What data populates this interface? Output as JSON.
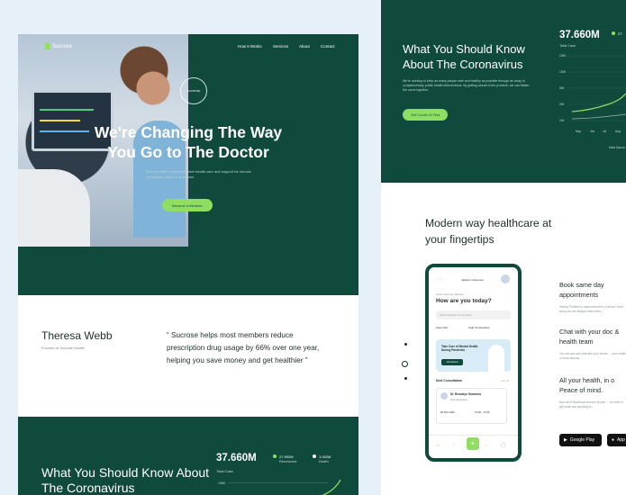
{
  "hero": {
    "logo": "Sucrose",
    "nav": [
      "How It Works",
      "Services",
      "About",
      "Contact"
    ],
    "badge_text": "SUCROSE",
    "title_line1": "We're Changing The Way",
    "title_line2": "You Go to The Doctor",
    "subtitle": "Sucrose offers comprehensive health care and support for chronic conditions, online or in person.",
    "cta": "Become a Member"
  },
  "testimonial": {
    "name": "Theresa Webb",
    "role": "Founder of Sucrose Health",
    "quote": "“ Sucrose helps most members reduce prescription drug usage by 66% over one year, helping you save money and get healthier ”"
  },
  "stats_section": {
    "title": "What You Should Know About The Coronavirus",
    "big_number": "37.660M",
    "big_label": "Total Case",
    "recovered_value": "27.902M",
    "recovered_label": "Recovered",
    "death_value": "1.052M",
    "death_label": "Death",
    "axis_top": "136K"
  },
  "right_top": {
    "title": "What You Should Know About The Coronavirus",
    "body": "We're working to keep as many people safe and healthy as possible through an array of complementary public health interventions. By getting ahead of the problem, we can flatten the curve together.",
    "cta": "Get Covid-19 Test",
    "big_number": "37.660M",
    "big_label": "Total Case",
    "legend_value": "27.",
    "y_ticks": [
      "136K",
      "100K",
      "50K",
      "20K",
      "10K"
    ],
    "x_ticks": [
      "May",
      "Jun",
      "Jul",
      "Aug"
    ],
    "source": "Data Source"
  },
  "right_bottom": {
    "title": "Modern way healthcare at your fingertips",
    "phone": {
      "location": "Jakarta, Indonesia",
      "greeting": "Good morning, Zaynne",
      "question": "How are you today?",
      "search": "Search Doctor or Symptom",
      "chips": [
        "Fast Cold",
        "High Temperature"
      ],
      "promo": "Take Care of Mental Health During Pandemic",
      "promo_btn": "Join Event",
      "section": "Next Consultation",
      "see_all": "See All",
      "doctor": "Dr. Brooklyn Simmons",
      "specialty": "Dermatologists",
      "date": "28 Mar 2020",
      "time": "13:00 - 14:00"
    },
    "features": [
      {
        "title": "Book same day appointments",
        "desc": "Having Problem to appointment for a doctor? don't worry we can always meet every..."
      },
      {
        "title": "Chat with your doc & health team",
        "desc": "You can ask and chat with your doctor ... your health or even discuss ..."
      },
      {
        "title": "All your health, in o Peace of mind.",
        "desc": "Now all of healthcare service at your ... no need to get panic any anything m..."
      }
    ],
    "store1": "Google Play",
    "store2": "App"
  },
  "colors": {
    "brand_green": "#0f4a3d",
    "accent_lime": "#8fde63"
  }
}
